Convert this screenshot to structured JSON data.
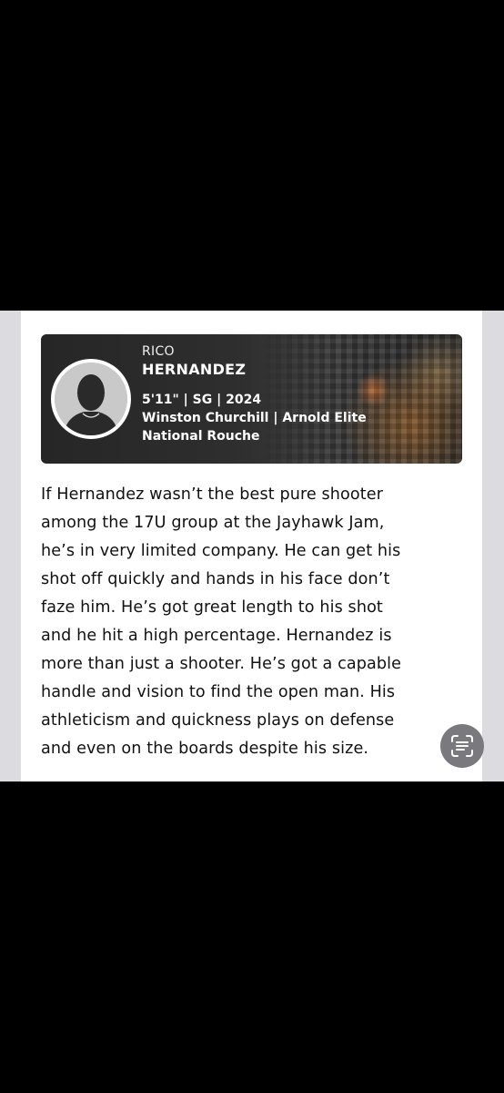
{
  "profile": {
    "first_name": "RICO",
    "last_name": "HERNANDEZ",
    "stats_line": "5'11\" | SG | 2024",
    "school_line": "Winston Churchill | Arnold Elite",
    "team_line": "National Rouche",
    "avatar_icon": "person-silhouette-icon"
  },
  "article": {
    "lines": [
      "If Hernandez wasn’t the best pure shooter",
      "among the 17U group at the Jayhawk Jam,",
      "he’s in very limited company. He can get his",
      "shot off quickly and hands in his face don’t",
      "faze him. He’s got great length to his shot",
      "and he hit a high percentage. Hernandez is",
      "more than just a shooter. He’s got a capable",
      "handle and vision to find the open man. His",
      "athleticism and quickness plays on defense",
      "and even on the boards despite his size."
    ]
  },
  "controls": {
    "scan_text_icon": "live-text-scan-icon"
  },
  "colors": {
    "background": "#000000",
    "card": "#ffffff",
    "banner": "#2e2e2e",
    "text": "#111111",
    "scan_button": "#7a7a7e"
  }
}
